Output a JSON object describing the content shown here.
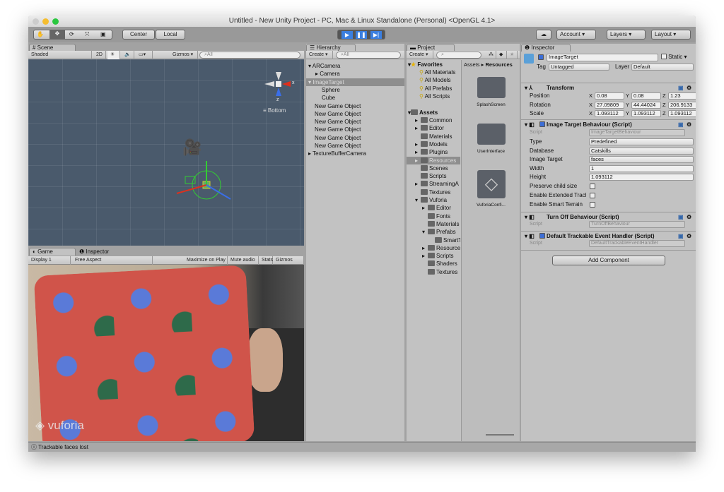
{
  "window": {
    "title": "Untitled - New Unity Project - PC, Mac & Linux Standalone (Personal) <OpenGL 4.1>"
  },
  "toolbar": {
    "tools": [
      "hand-icon",
      "move-icon",
      "rotate-icon",
      "scale-icon",
      "rect-icon"
    ],
    "pivot": "Center",
    "space": "Local",
    "account": "Account",
    "layers": "Layers",
    "layout": "Layout"
  },
  "scene": {
    "tab": "Scene",
    "shading": "Shaded",
    "mode_2d": "2D",
    "gizmos": "Gizmos",
    "search_placeholder": "All",
    "view_label": "Bottom",
    "axis_x": "x",
    "axis_z": "z"
  },
  "game": {
    "tab": "Game",
    "inspector_tab": "Inspector",
    "display": "Display 1",
    "aspect": "Free Aspect",
    "maximize": "Maximize on Play",
    "mute": "Mute audio",
    "stats": "Stats",
    "gizmos": "Gizmos",
    "watermark": "vuforia"
  },
  "hierarchy": {
    "tab": "Hierarchy",
    "create": "Create",
    "search_placeholder": "All",
    "items": [
      {
        "label": "ARCamera",
        "indent": 0,
        "arrow": "down"
      },
      {
        "label": "Camera",
        "indent": 1,
        "arrow": "right"
      },
      {
        "label": "ImageTarget",
        "indent": 0,
        "arrow": "down",
        "selected": true
      },
      {
        "label": "Sphere",
        "indent": 1
      },
      {
        "label": "Cube",
        "indent": 1
      },
      {
        "label": "New Game Object",
        "indent": 0
      },
      {
        "label": "New Game Object",
        "indent": 0
      },
      {
        "label": "New Game Object",
        "indent": 0
      },
      {
        "label": "New Game Object",
        "indent": 0
      },
      {
        "label": "New Game Object",
        "indent": 0
      },
      {
        "label": "New Game Object",
        "indent": 0
      },
      {
        "label": "TextureBufferCamera",
        "indent": 0,
        "arrow": "right"
      }
    ]
  },
  "project": {
    "tab": "Project",
    "create": "Create",
    "breadcrumb": [
      "Assets",
      "Resources"
    ],
    "favorites_label": "Favorites",
    "favorites": [
      "All Materials",
      "All Models",
      "All Prefabs",
      "All Scripts"
    ],
    "assets_label": "Assets",
    "tree": [
      {
        "label": "Common",
        "indent": 1,
        "arrow": true
      },
      {
        "label": "Editor",
        "indent": 1,
        "arrow": true
      },
      {
        "label": "Materials",
        "indent": 1
      },
      {
        "label": "Models",
        "indent": 1,
        "arrow": true
      },
      {
        "label": "Plugins",
        "indent": 1,
        "arrow": true
      },
      {
        "label": "Resources",
        "indent": 1,
        "arrow": true,
        "selected": true
      },
      {
        "label": "Scenes",
        "indent": 1
      },
      {
        "label": "Scripts",
        "indent": 1
      },
      {
        "label": "StreamingA",
        "indent": 1,
        "arrow": true
      },
      {
        "label": "Textures",
        "indent": 1
      },
      {
        "label": "Vuforia",
        "indent": 1,
        "arrow": true,
        "open": true
      },
      {
        "label": "Editor",
        "indent": 2,
        "arrow": true
      },
      {
        "label": "Fonts",
        "indent": 2
      },
      {
        "label": "Materials",
        "indent": 2
      },
      {
        "label": "Prefabs",
        "indent": 2,
        "arrow": true,
        "open": true
      },
      {
        "label": "SmartT",
        "indent": 3
      },
      {
        "label": "Resource",
        "indent": 2,
        "arrow": true
      },
      {
        "label": "Scripts",
        "indent": 2,
        "arrow": true
      },
      {
        "label": "Shaders",
        "indent": 2
      },
      {
        "label": "Textures",
        "indent": 2
      }
    ],
    "grid": [
      {
        "label": "SplashScreen",
        "kind": "folder"
      },
      {
        "label": "UserInterface",
        "kind": "folder"
      },
      {
        "label": "VuforiaConfi...",
        "kind": "unity-asset"
      }
    ]
  },
  "inspector": {
    "tab": "Inspector",
    "object_name": "ImageTarget",
    "static_label": "Static",
    "tag_label": "Tag",
    "tag": "Untagged",
    "layer_label": "Layer",
    "layer": "Default",
    "transform": {
      "title": "Transform",
      "rows": [
        {
          "label": "Position",
          "x": "0.08",
          "y": "0.08",
          "z": "1.23"
        },
        {
          "label": "Rotation",
          "x": "27.09809",
          "y": "44.44024",
          "z": "206.9133"
        },
        {
          "label": "Scale",
          "x": "1.093112",
          "y": "1.093112",
          "z": "1.093112"
        }
      ]
    },
    "itb": {
      "title": "Image Target Behaviour (Script)",
      "script_label": "Script",
      "script": "ImageTargetBehaviour",
      "type_label": "Type",
      "type": "Predefined",
      "db_label": "Database",
      "db": "Catskills",
      "target_label": "Image Target",
      "target": "faces",
      "width_label": "Width",
      "width": "1",
      "height_label": "Height",
      "height": "1.093112",
      "preserve": "Preserve child size",
      "extended": "Enable Extended Tracl",
      "smart": "Enable Smart Terrain"
    },
    "turnoff": {
      "title": "Turn Off Behaviour (Script)",
      "script_label": "Script",
      "script": "TurnOffBehaviour"
    },
    "dteh": {
      "title": "Default Trackable Event Handler (Script)",
      "script_label": "Script",
      "script": "DefaultTrackableEventHandler"
    },
    "add_component": "Add Component"
  },
  "status": {
    "message": "Trackable faces lost"
  },
  "colors": {
    "accent": "#3c6ed6",
    "scene_bg": "#4a5a6c",
    "selection": "#8e8e8e"
  }
}
